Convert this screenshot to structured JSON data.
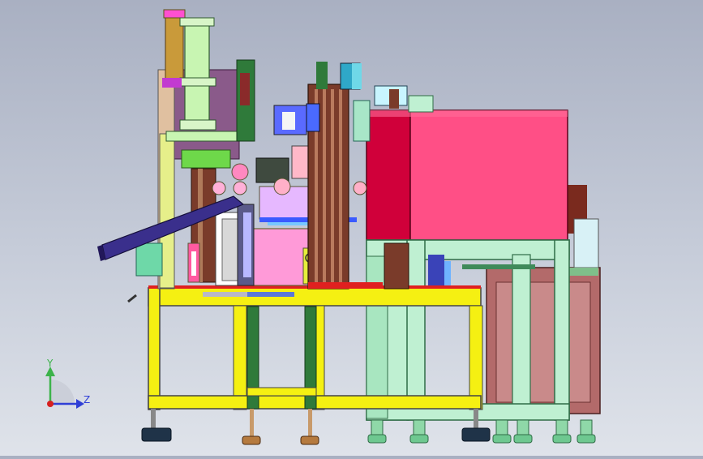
{
  "triad": {
    "y_label": "Y",
    "z_label": "Z",
    "y_color": "#3cb34a",
    "z_color": "#2f3fd6",
    "x_color": "#d62020"
  },
  "colors": {
    "frame_yellow": "#f5f012",
    "guard_pink": "#ff4f86",
    "guard_red": "#d0003a",
    "frame_mint": "#bff0d2",
    "frame_mint_edge": "#2f6c46",
    "pillar_brown": "#c27a5a",
    "cylinder_green": "#c8f5b2",
    "cylinder_brass": "#c99a3a",
    "chute_navy": "#3a2f8c",
    "column_brown": "#7a3b2a",
    "support_green": "#2f7a3a",
    "foot_navy": "#1f3348",
    "foot_brass": "#b57a3e"
  }
}
